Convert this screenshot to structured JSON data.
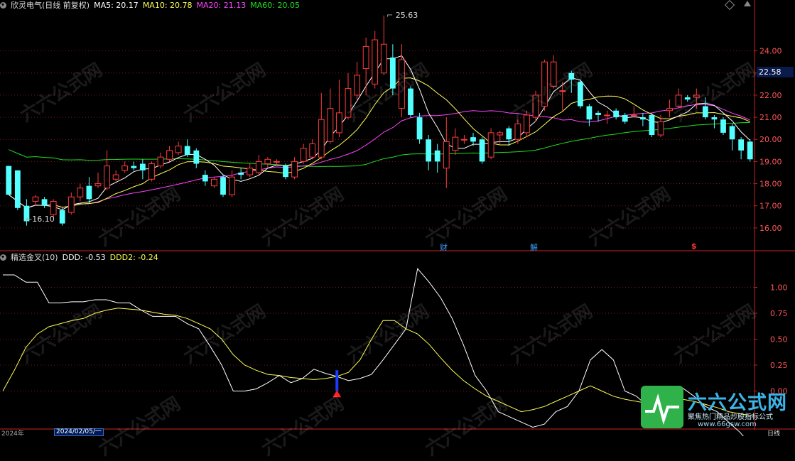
{
  "main_header": {
    "title": "欣灵电气(日线 前复权)",
    "ma5": "MA5: 20.17",
    "ma10": "MA10: 20.78",
    "ma20": "MA20: 21.13",
    "ma60": "MA60: 20.05"
  },
  "sub_header": {
    "title": "精选金叉(10)",
    "ddd": "DDD: -0.53",
    "ddd2": "DDD2: -0.24"
  },
  "markers": {
    "cai": "财",
    "jie": "解",
    "dollar": "$"
  },
  "annotations": {
    "high": "25.63",
    "low": "16.10"
  },
  "price_badge": "22.58",
  "time_axis": {
    "left": "2024年",
    "date_box": "2024/02/05/一",
    "right": "日线"
  },
  "logo": {
    "text": "六六公式网",
    "sub": "聚焦热门精品炒股指标公式",
    "url": "www.66gsw.com"
  },
  "watermark": "六六公式网",
  "colors": {
    "up": "#ff3c3c",
    "down": "#54ffff",
    "ma5": "#ffffff",
    "ma10": "#ffff55",
    "ma20": "#ff44ff",
    "ma60": "#22dd22",
    "grid": "#7a1818",
    "axis": "#cc2222"
  },
  "chart_data": [
    {
      "type": "candlestick",
      "yticks": [
        16.0,
        17.0,
        18.0,
        19.0,
        20.0,
        21.0,
        22.0,
        23.0,
        24.0
      ],
      "ylim": [
        15.0,
        25.85
      ],
      "candles": [
        [
          18.8,
          17.5,
          18.8,
          17.5
        ],
        [
          18.6,
          16.9,
          18.6,
          16.8
        ],
        [
          17.0,
          16.3,
          17.3,
          16.1
        ],
        [
          17.2,
          17.4,
          17.5,
          17.0
        ],
        [
          17.3,
          17.0,
          17.4,
          16.9
        ],
        [
          16.6,
          17.2,
          17.3,
          16.5
        ],
        [
          16.8,
          16.2,
          16.9,
          16.1
        ],
        [
          16.7,
          17.4,
          17.6,
          16.6
        ],
        [
          17.4,
          17.8,
          18.0,
          17.2
        ],
        [
          17.9,
          17.3,
          18.3,
          17.1
        ],
        [
          17.9,
          18.0,
          18.5,
          17.8
        ],
        [
          17.8,
          18.8,
          19.5,
          17.7
        ],
        [
          18.2,
          18.4,
          18.6,
          18.1
        ],
        [
          18.6,
          18.8,
          19.0,
          18.5
        ],
        [
          18.8,
          18.7,
          19.0,
          18.6
        ],
        [
          18.9,
          18.6,
          19.1,
          18.2
        ],
        [
          18.2,
          18.9,
          19.0,
          18.1
        ],
        [
          18.8,
          19.2,
          19.4,
          18.7
        ],
        [
          19.1,
          19.5,
          19.7,
          19.0
        ],
        [
          19.4,
          19.7,
          19.9,
          19.3
        ],
        [
          19.7,
          19.3,
          20.0,
          19.2
        ],
        [
          19.5,
          18.9,
          19.6,
          18.7
        ],
        [
          18.4,
          18.1,
          18.6,
          17.9
        ],
        [
          17.9,
          18.2,
          18.3,
          17.8
        ],
        [
          18.3,
          17.5,
          18.4,
          17.4
        ],
        [
          17.5,
          18.3,
          18.6,
          17.4
        ],
        [
          18.5,
          18.4,
          18.7,
          18.2
        ],
        [
          18.4,
          18.7,
          18.9,
          18.3
        ],
        [
          18.5,
          19.0,
          19.3,
          18.4
        ],
        [
          18.9,
          19.1,
          19.2,
          18.7
        ],
        [
          19.0,
          19.0,
          19.1,
          18.8
        ],
        [
          18.8,
          18.3,
          18.9,
          18.2
        ],
        [
          18.3,
          19.0,
          19.2,
          18.2
        ],
        [
          19.0,
          19.6,
          19.8,
          18.9
        ],
        [
          19.2,
          19.8,
          20.0,
          19.1
        ],
        [
          19.2,
          20.9,
          22.1,
          19.1
        ],
        [
          19.9,
          21.4,
          22.3,
          19.8
        ],
        [
          20.3,
          21.2,
          22.7,
          20.1
        ],
        [
          21.0,
          22.3,
          23.0,
          20.9
        ],
        [
          22.0,
          22.9,
          23.5,
          21.8
        ],
        [
          23.2,
          24.2,
          24.6,
          22.0
        ],
        [
          22.5,
          24.5,
          24.9,
          22.3
        ],
        [
          23.0,
          24.3,
          25.6,
          22.9
        ],
        [
          23.7,
          22.3,
          24.3,
          22.0
        ],
        [
          21.4,
          23.6,
          24.3,
          21.0
        ],
        [
          22.3,
          21.1,
          22.4,
          21.0
        ],
        [
          21.0,
          20.0,
          21.2,
          19.8
        ],
        [
          20.0,
          19.0,
          20.2,
          18.6
        ],
        [
          19.5,
          19.0,
          19.8,
          18.5
        ],
        [
          18.7,
          19.9,
          21.0,
          17.8
        ],
        [
          19.5,
          20.1,
          20.5,
          19.3
        ],
        [
          20.0,
          20.0,
          20.2,
          19.8
        ],
        [
          20.1,
          19.9,
          20.3,
          19.7
        ],
        [
          20.0,
          19.0,
          20.1,
          18.9
        ],
        [
          19.2,
          20.3,
          20.5,
          19.1
        ],
        [
          20.2,
          20.3,
          20.4,
          19.8
        ],
        [
          20.5,
          20.0,
          20.6,
          19.7
        ],
        [
          20.0,
          20.7,
          20.9,
          19.8
        ],
        [
          20.3,
          21.1,
          21.3,
          20.1
        ],
        [
          21.0,
          22.0,
          22.2,
          20.8
        ],
        [
          21.5,
          23.5,
          23.6,
          21.3
        ],
        [
          22.4,
          23.5,
          23.8,
          22.3
        ],
        [
          22.2,
          22.2,
          22.6,
          21.3
        ],
        [
          23.0,
          22.7,
          23.1,
          22.1
        ],
        [
          22.6,
          21.5,
          22.7,
          21.4
        ],
        [
          21.5,
          20.9,
          21.6,
          20.6
        ],
        [
          21.2,
          21.1,
          21.3,
          20.8
        ],
        [
          21.1,
          21.1,
          21.3,
          20.7
        ],
        [
          21.3,
          21.0,
          21.4,
          20.9
        ],
        [
          21.1,
          20.8,
          21.2,
          20.7
        ],
        [
          21.1,
          21.1,
          21.5,
          21.0
        ],
        [
          21.0,
          20.9,
          21.2,
          20.6
        ],
        [
          21.1,
          20.2,
          21.2,
          20.1
        ],
        [
          20.2,
          20.8,
          21.1,
          20.1
        ],
        [
          21.3,
          21.4,
          21.8,
          21.0
        ],
        [
          21.5,
          22.0,
          22.3,
          21.4
        ],
        [
          21.9,
          21.8,
          22.0,
          21.7
        ],
        [
          21.9,
          22.0,
          22.3,
          21.4
        ],
        [
          21.5,
          21.0,
          21.9,
          20.9
        ],
        [
          21.0,
          20.9,
          21.1,
          20.5
        ],
        [
          20.9,
          20.3,
          21.0,
          20.2
        ],
        [
          20.6,
          20.0,
          20.7,
          19.5
        ],
        [
          20.0,
          19.5,
          20.1,
          19.1
        ],
        [
          19.9,
          19.1,
          20.0,
          19.0
        ]
      ],
      "ma_start": {
        "ma5": 4,
        "ma10": 9,
        "ma20": 19,
        "ma60": 0
      }
    },
    {
      "type": "line",
      "yticks": [
        0.0,
        0.25,
        0.5,
        0.75,
        1.0
      ],
      "ylim": [
        -0.36,
        1.25
      ],
      "series": [
        {
          "name": "DDD",
          "values": [
            1.12,
            1.12,
            1.05,
            1.05,
            0.85,
            0.85,
            0.86,
            0.86,
            0.88,
            0.88,
            0.85,
            0.85,
            0.78,
            0.72,
            0.72,
            0.72,
            0.65,
            0.6,
            0.43,
            0.25,
            0.0,
            0.0,
            0.02,
            0.08,
            0.15,
            0.08,
            0.12,
            0.21,
            0.17,
            0.14,
            0.1,
            0.12,
            0.16,
            0.3,
            0.45,
            0.6,
            1.18,
            1.05,
            0.9,
            0.7,
            0.44,
            0.15,
            0.0,
            -0.2,
            -0.25,
            -0.3,
            -0.35,
            -0.32,
            -0.2,
            -0.15,
            0.0,
            0.3,
            0.4,
            0.3,
            0.0,
            -0.05,
            -0.15,
            -0.25,
            -0.05,
            0.03,
            -0.05,
            -0.15,
            -0.2,
            -0.3,
            -0.4,
            -0.53
          ]
        },
        {
          "name": "DDD2",
          "values": [
            0.0,
            0.2,
            0.42,
            0.55,
            0.62,
            0.65,
            0.68,
            0.7,
            0.75,
            0.78,
            0.8,
            0.79,
            0.78,
            0.76,
            0.74,
            0.73,
            0.7,
            0.65,
            0.6,
            0.5,
            0.35,
            0.25,
            0.2,
            0.16,
            0.15,
            0.13,
            0.12,
            0.11,
            0.12,
            0.14,
            0.18,
            0.3,
            0.5,
            0.68,
            0.68,
            0.6,
            0.55,
            0.45,
            0.32,
            0.2,
            0.1,
            0.02,
            -0.05,
            -0.1,
            -0.15,
            -0.2,
            -0.18,
            -0.15,
            -0.1,
            -0.05,
            0.0,
            0.05,
            0.0,
            -0.05,
            -0.08,
            -0.1,
            -0.12,
            -0.1,
            -0.09,
            -0.08,
            -0.1,
            -0.13,
            -0.16,
            -0.2,
            -0.22,
            -0.24
          ]
        }
      ],
      "signal_index": 29
    }
  ]
}
